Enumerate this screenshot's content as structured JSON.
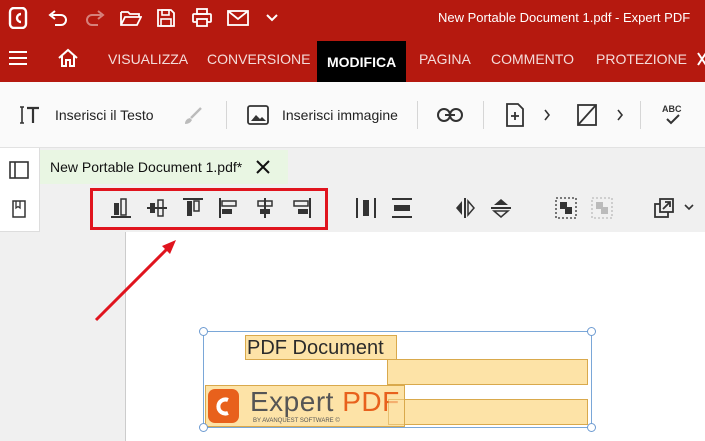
{
  "window": {
    "title": "New Portable Document 1.pdf  -  Expert PDF"
  },
  "menu": {
    "tabs": [
      {
        "label": "VISUALIZZA"
      },
      {
        "label": "CONVERSIONE"
      },
      {
        "label": "MODIFICA",
        "active": true
      },
      {
        "label": "PAGINA"
      },
      {
        "label": "COMMENTO"
      },
      {
        "label": "PROTEZIONE"
      }
    ]
  },
  "toolbar": {
    "insert_text_label": "Inserisci il Testo",
    "insert_image_label": "Inserisci immagine"
  },
  "document_tab": {
    "label": "New Portable Document 1.pdf*"
  },
  "canvas": {
    "text_box": "PDF Document",
    "logo_word": "Expert ",
    "logo_pdf": "PDF",
    "logo_sub": "BY AVANQUEST SOFTWARE ©"
  },
  "colors": {
    "brand_red": "#b5190f",
    "active_tab": "#000000",
    "doc_tab": "#e9f6e3",
    "highlight_box": "#e0141e",
    "field_fill": "#fde3a7",
    "logo_orange": "#e8611c"
  },
  "icons": [
    "app-logo-icon",
    "undo-icon",
    "redo-icon",
    "open-folder-icon",
    "save-icon",
    "print-icon",
    "mail-icon",
    "chevron-down-icon",
    "hamburger-menu-icon",
    "home-icon",
    "insert-text-icon",
    "brush-icon",
    "image-icon",
    "link-icon",
    "add-page-icon",
    "crop-icon",
    "spellcheck-icon",
    "close-icon"
  ]
}
